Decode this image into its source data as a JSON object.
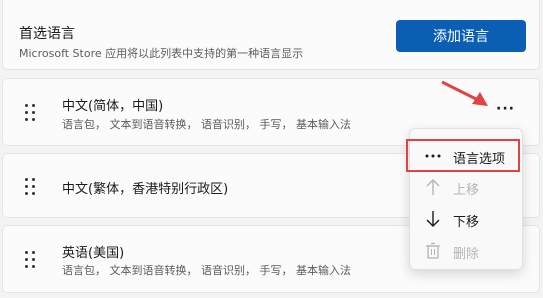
{
  "preferred": {
    "title": "首选语言",
    "subtitle": "Microsoft Store 应用将以此列表中支持的第一种语言显示",
    "add_button": "添加语言"
  },
  "languages": [
    {
      "name": "中文(简体，中国)",
      "features": "语言包，  文本到语音转换，  语音识别，  手写，  基本输入法"
    },
    {
      "name": "中文(繁体，香港特别行政区)",
      "features": ""
    },
    {
      "name": "英语(美国)",
      "features": "语言包，  文本到语音转换，  语音识别，  手写，  基本输入法"
    }
  ],
  "more_button": "···",
  "context_menu": {
    "items": [
      {
        "label": "语言选项",
        "icon": "more-icon",
        "enabled": true,
        "highlighted": true
      },
      {
        "label": "上移",
        "icon": "arrow-up-icon",
        "enabled": false
      },
      {
        "label": "下移",
        "icon": "arrow-down-icon",
        "enabled": true
      },
      {
        "label": "删除",
        "icon": "trash-icon",
        "enabled": false
      }
    ]
  },
  "colors": {
    "accent": "#0a5fb4",
    "highlight": "#e04343",
    "annotation_arrow": "#e04343"
  }
}
